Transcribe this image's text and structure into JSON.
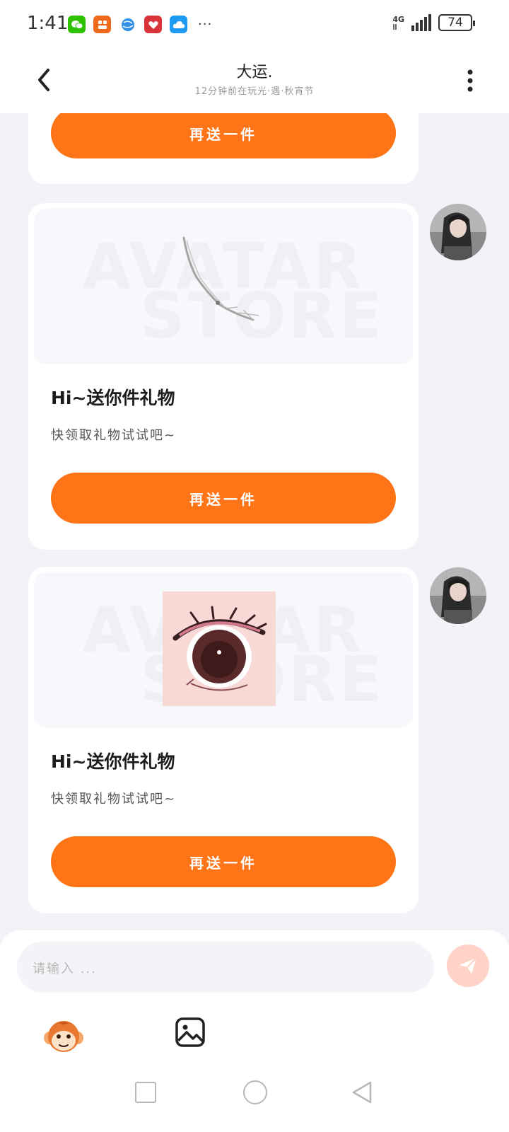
{
  "status": {
    "time": "1:41",
    "apps": [
      "wechat-icon",
      "app-icon",
      "browser-icon",
      "game-icon",
      "cloud-icon"
    ],
    "more": "···",
    "network": "4G",
    "battery": "74"
  },
  "header": {
    "title": "大运.",
    "subtitle": "12分钟前在玩光·遇·秋宵节"
  },
  "cards": [
    {
      "title": "",
      "desc": "",
      "button": "再送一件"
    },
    {
      "title": "Hi~送你件礼物",
      "desc": "快领取礼物试试吧~",
      "button": "再送一件"
    },
    {
      "title": "Hi~送你件礼物",
      "desc": "快领取礼物试试吧~",
      "button": "再送一件"
    }
  ],
  "input": {
    "placeholder": "请输入 ..."
  },
  "colors": {
    "accent": "#ff7416",
    "send": "#ffd3c7",
    "background": "#f1f3f8"
  }
}
